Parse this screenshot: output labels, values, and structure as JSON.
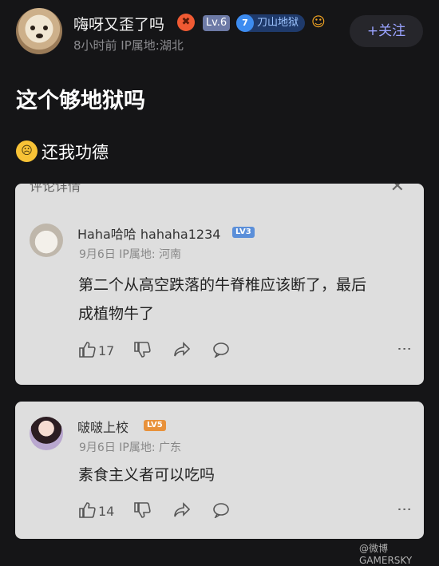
{
  "header": {
    "username": "嗨呀又歪了吗",
    "angry_icon": "angry-face-icon",
    "level": "Lv.6",
    "group_number": "7",
    "group_name": "刀山地狱",
    "game_icon": "game-controller-icon",
    "meta": "8小时前  IP属地:湖北",
    "follow_label": "+关注"
  },
  "post": {
    "title": "这个够地狱吗",
    "body_icon": "crying-face-icon",
    "body": "还我功德"
  },
  "comment_sheet": {
    "header_label": "评论详情",
    "close_icon": "close-icon"
  },
  "comments": [
    {
      "name": "Haha哈哈 hahaha1234",
      "level": "LV3",
      "meta": "9月6日  IP属地: 河南",
      "text_line1": "第二个从高空跌落的牛脊椎应该断了，最后",
      "text_line2": "成植物牛了",
      "likes": "17"
    },
    {
      "name": "啵啵上校",
      "level": "LV5",
      "meta": "9月6日  IP属地: 广东",
      "text": "素食主义者可以吃吗",
      "likes": "14"
    }
  ],
  "icons": {
    "like": "thumbs-up-icon",
    "dislike": "thumbs-down-icon",
    "share": "share-icon",
    "reply": "comment-icon",
    "more": "more-icon"
  },
  "colors": {
    "background": "#151517",
    "follow_text": "#9aa3ff",
    "level_badge": "#6d7aa6",
    "group_badge": "#1f3a6b",
    "lv3_chip": "#5b8fd9",
    "lv5_chip": "#e8913a"
  },
  "watermark": "@微博 GAMERSKY"
}
